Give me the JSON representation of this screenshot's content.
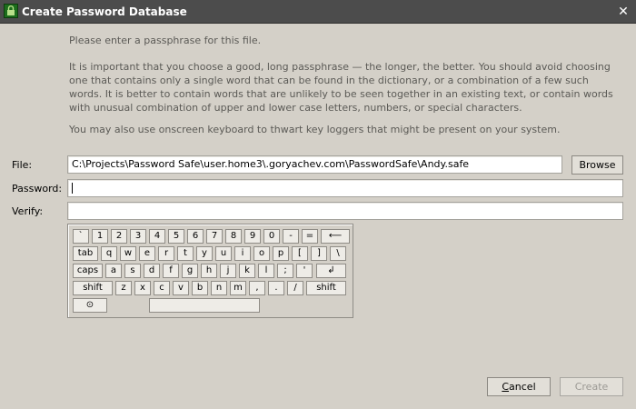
{
  "window": {
    "title": "Create Password Database",
    "close": "✕"
  },
  "instructions": {
    "p1": "Please enter a passphrase for this file.",
    "p2": "It is important that you choose a good, long passphrase — the longer, the better. You should avoid choosing one that contains only a single word that can be found in the dictionary, or a combination of a few such words. It is better to contain words that are unlikely to be seen together in an existing text, or contain words with unusual combination of upper and lower case letters, numbers, or special characters.",
    "p3": "You may also use onscreen keyboard to thwart key loggers that might be present on your system."
  },
  "form": {
    "file_label": "File:",
    "file_value": "C:\\Projects\\Password Safe\\user.home3\\.goryachev.com\\PasswordSafe\\Andy.safe",
    "password_label": "Password:",
    "password_value": "",
    "verify_label": "Verify:",
    "verify_value": "",
    "browse_label": "Browse"
  },
  "keyboard": {
    "rows": [
      [
        "`",
        "1",
        "2",
        "3",
        "4",
        "5",
        "6",
        "7",
        "8",
        "9",
        "0",
        "-",
        "=",
        "⟵"
      ],
      [
        "tab",
        "q",
        "w",
        "e",
        "r",
        "t",
        "y",
        "u",
        "i",
        "o",
        "p",
        "[",
        "]",
        "\\"
      ],
      [
        "caps",
        "a",
        "s",
        "d",
        "f",
        "g",
        "h",
        "j",
        "k",
        "l",
        ";",
        "'",
        "↲"
      ],
      [
        "shift",
        "z",
        "x",
        "c",
        "v",
        "b",
        "n",
        "m",
        ",",
        ".",
        "/",
        "shift"
      ],
      [
        "⊙",
        ""
      ]
    ]
  },
  "buttons": {
    "cancel_first": "C",
    "cancel_rest": "ancel",
    "create": "Create"
  }
}
